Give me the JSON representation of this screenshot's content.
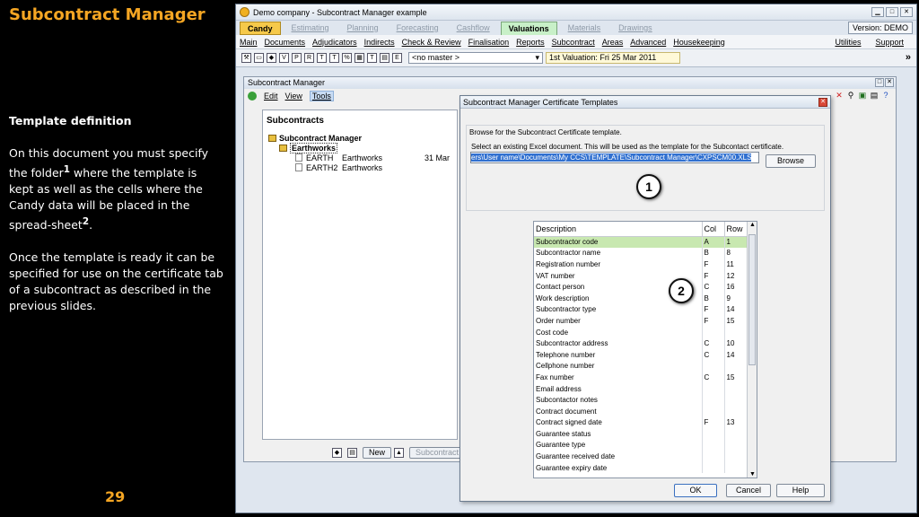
{
  "slide": {
    "title": "Subcontract Manager",
    "heading": "Template definition",
    "para1_a": "On this document you must specify the folder",
    "para1_sup1": "1",
    "para1_b": " where the template is kept as well as the cells where the Candy data will be placed in the spread-sheet",
    "para1_sup2": "2",
    "para1_c": ".",
    "para2": "Once the template is ready it can be specified for use on the certificate tab of a subcontract as described in the previous slides.",
    "page_number": "29"
  },
  "app": {
    "title": "Demo company - Subcontract Manager example",
    "version": "Version: DEMO",
    "tabs": [
      "Candy",
      "Estimating",
      "Planning",
      "Forecasting",
      "Cashflow",
      "Valuations",
      "Materials",
      "Drawings"
    ],
    "menu": [
      "Main",
      "Documents",
      "Adjudicators",
      "Indirects",
      "Check & Review",
      "Finalisation",
      "Reports",
      "Subcontract",
      "Areas",
      "Advanced",
      "Housekeeping"
    ],
    "menu_right": [
      "Utilities",
      "Support"
    ],
    "toolbar": {
      "master": "<no master >",
      "valuation": "1st Valuation: Fri 25 Mar 2011"
    }
  },
  "inner": {
    "title": "Subcontract Manager",
    "menu": [
      "Edit",
      "View",
      "Tools"
    ],
    "tree_header": "Subcontracts",
    "root": "Subcontract Manager",
    "folder": "Earthworks",
    "items": [
      {
        "code": "EARTH",
        "name": "Earthworks",
        "date": "31 Mar"
      },
      {
        "code": "EARTH2",
        "name": "Earthworks",
        "date": ""
      }
    ],
    "buttons": {
      "new": "New",
      "bill": "Subcontract bill"
    }
  },
  "dialog": {
    "title": "Subcontract Manager Certificate Templates",
    "browse_label": "Browse for the Subcontract Certificate template.",
    "select_label": "Select an existing Excel document. This will be used as the template for the Subcontact certificate.",
    "path": "ers\\User name\\Documents\\My CCS\\TEMPLATE\\Subcontract Manager\\CXPSCM00.XLS",
    "browse_button": "Browse",
    "callout1": "1",
    "callout2": "2",
    "columns": [
      "Description",
      "Col",
      "Row"
    ],
    "rows": [
      [
        "Subcontractor code",
        "A",
        "1"
      ],
      [
        "Subcontractor name",
        "B",
        "8"
      ],
      [
        "Registration number",
        "F",
        "11"
      ],
      [
        "VAT number",
        "F",
        "12"
      ],
      [
        "Contact person",
        "C",
        "16"
      ],
      [
        "Work description",
        "B",
        "9"
      ],
      [
        "Subcontractor type",
        "F",
        "14"
      ],
      [
        "Order number",
        "F",
        "15"
      ],
      [
        "Cost code",
        "",
        ""
      ],
      [
        "Subcontractor address",
        "C",
        "10"
      ],
      [
        "Telephone number",
        "C",
        "14"
      ],
      [
        "Cellphone number",
        "",
        ""
      ],
      [
        "Fax number",
        "C",
        "15"
      ],
      [
        "Email address",
        "",
        ""
      ],
      [
        "Subcontactor notes",
        "",
        ""
      ],
      [
        "Contract document",
        "",
        ""
      ],
      [
        "Contract signed date",
        "F",
        "13"
      ],
      [
        "Guarantee status",
        "",
        ""
      ],
      [
        "Guarantee type",
        "",
        ""
      ],
      [
        "Guarantee received date",
        "",
        ""
      ],
      [
        "Guarantee expiry date",
        "",
        ""
      ]
    ],
    "ok": "OK",
    "cancel": "Cancel",
    "help": "Help"
  },
  "colors": {
    "accent": "#f5a623",
    "selection": "#3070d0",
    "row_highlight": "#c8e8b0"
  }
}
